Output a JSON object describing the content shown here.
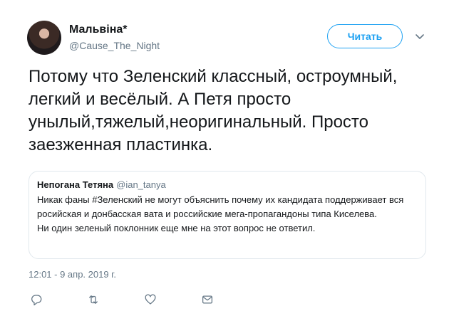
{
  "author": {
    "display_name": "Мальвіна*",
    "handle": "@Cause_The_Night"
  },
  "follow_button": {
    "label": "Читать"
  },
  "tweet": {
    "text": "Потому что Зеленский классный, остроумный, легкий и весёлый. А Петя просто унылый,тяжелый,неоригинальный. Просто заезженная пластинка.",
    "timestamp": "12:01 - 9 апр. 2019 г."
  },
  "quoted_tweet": {
    "display_name": "Непогана Тетяна",
    "handle": "@ian_tanya",
    "text": "Никак фаны #Зеленский не могут объяснить почему их кандидата поддерживает вся росийская и донбасская вата и российские мега-пропагандоны типа Киселева.\nНи один зеленый поклонник еще мне на этот вопрос не ответил."
  },
  "actions": [
    {
      "icon": "reply-icon"
    },
    {
      "icon": "retweet-icon"
    },
    {
      "icon": "like-icon"
    },
    {
      "icon": "message-icon"
    }
  ],
  "colors": {
    "accent": "#1da1f2",
    "muted": "#657786",
    "border": "#e1e8ed",
    "text": "#14171a"
  }
}
